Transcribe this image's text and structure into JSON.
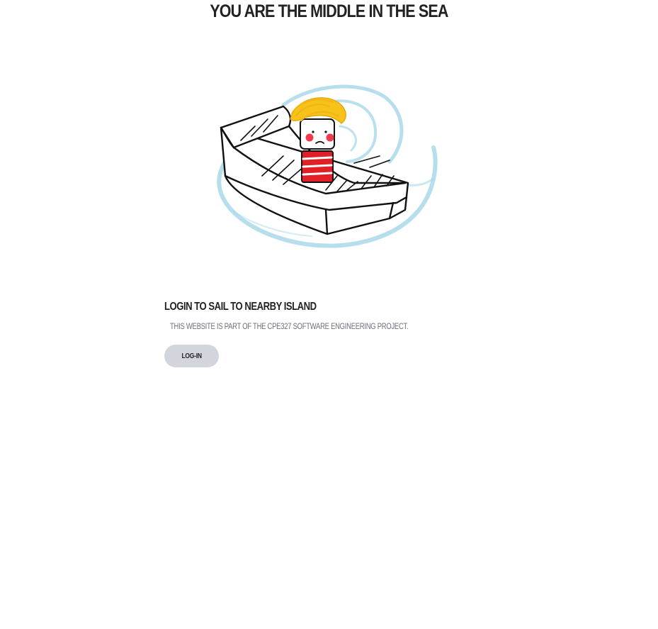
{
  "header": {
    "title": "YOU ARE THE MIDDLE IN THE SEA"
  },
  "illustration": {
    "icon": "boy-in-boat-whirlpool-drawing",
    "colors": {
      "water": "#9fd3e6",
      "hair": "#f7c21a",
      "shirt_red": "#e21f26",
      "cheeks": "#ef3b4a",
      "outline": "#111111"
    }
  },
  "main": {
    "subtitle": "LOGIN TO SAIL TO NEARBY ISLAND",
    "description": "THIS WEBSITE IS PART OF THE CPE327 SOFTWARE ENGINEERING PROJECT.",
    "login_button_label": "LOG-IN"
  },
  "colors": {
    "button_bg": "#d2d6dc",
    "muted_text": "#6b6f78"
  }
}
